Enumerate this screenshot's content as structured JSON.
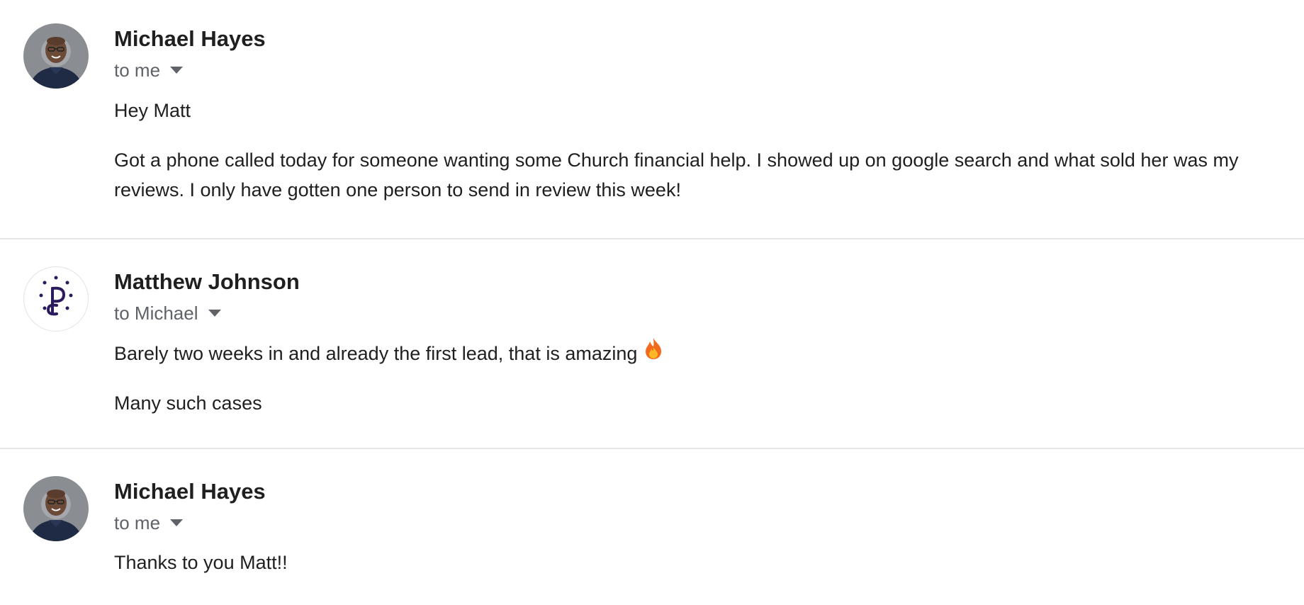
{
  "messages": [
    {
      "sender": "Michael Hayes",
      "recipient": "to me",
      "avatar": "person-photo",
      "body": [
        "Hey Matt",
        "Got a phone called today for someone wanting some Church financial help.  I showed up on  google search and what sold her was my reviews.  I only have gotten one person to send in review this week!"
      ]
    },
    {
      "sender": "Matthew Johnson",
      "recipient": "to Michael",
      "avatar": "logo-p-dots",
      "body": [
        "Barely two weeks in and already the first lead, that is amazing",
        "Many such cases"
      ],
      "emoji": "fire-icon"
    },
    {
      "sender": "Michael Hayes",
      "recipient": "to me",
      "avatar": "person-photo",
      "body": [
        "Thanks to you Matt!!"
      ]
    }
  ],
  "colors": {
    "sender": "#1f1f1f",
    "recipient": "#5f6368",
    "divider": "#e4e6e8",
    "logo": "#2b1a5e"
  }
}
